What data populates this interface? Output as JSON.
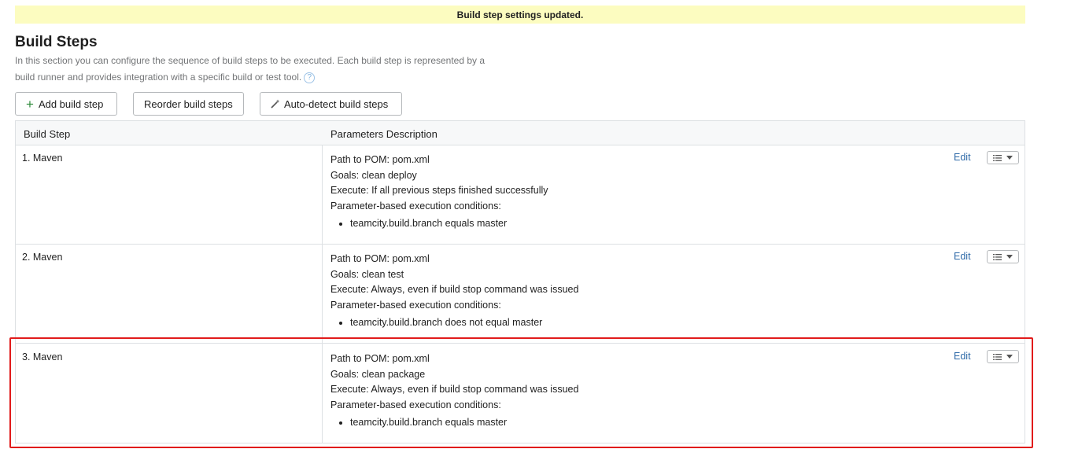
{
  "banner": {
    "message": "Build step settings updated."
  },
  "section": {
    "title": "Build Steps",
    "description": "In this section you can configure the sequence of build steps to be executed. Each build step is represented by a build runner and provides integration with a specific build or test tool."
  },
  "toolbar": {
    "add_label": "Add build step",
    "reorder_label": "Reorder build steps",
    "autodetect_label": "Auto-detect build steps"
  },
  "table": {
    "headers": {
      "step": "Build Step",
      "params": "Parameters Description"
    },
    "edit_label": "Edit",
    "rows": [
      {
        "name": "1. Maven",
        "pom": "Path to POM: pom.xml",
        "goals": "Goals: clean deploy",
        "execute": "Execute: If all previous steps finished successfully",
        "conditions_label": "Parameter-based execution conditions:",
        "condition": "teamcity.build.branch equals master"
      },
      {
        "name": "2. Maven",
        "pom": "Path to POM: pom.xml",
        "goals": "Goals: clean test",
        "execute": "Execute: Always, even if build stop command was issued",
        "conditions_label": "Parameter-based execution conditions:",
        "condition": "teamcity.build.branch does not equal master"
      },
      {
        "name": "3. Maven",
        "pom": "Path to POM: pom.xml",
        "goals": "Goals: clean package",
        "execute": "Execute: Always, even if build stop command was issued",
        "conditions_label": "Parameter-based execution conditions:",
        "condition": "teamcity.build.branch equals master"
      }
    ]
  },
  "colors": {
    "banner_bg": "#fcfcc0",
    "link": "#2f6aa8",
    "highlight": "#e11b1b",
    "plus": "#2d8a3a"
  }
}
